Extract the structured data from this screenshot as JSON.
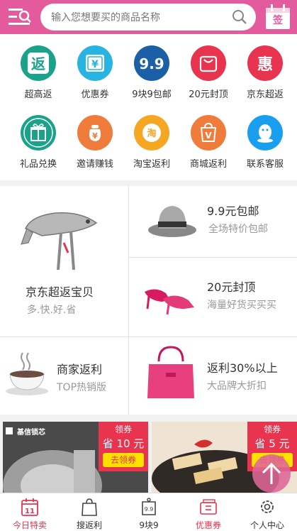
{
  "header": {
    "search_placeholder": "输入您想要买的商品名称",
    "sign_label": "签",
    "brand_color": "#e35b9c"
  },
  "grid": {
    "items": [
      {
        "label": "超高返",
        "icon": "fan-icon",
        "color": "#1aa38a",
        "glyph": "返"
      },
      {
        "label": "优惠券",
        "icon": "coupon-icon",
        "color": "#27b4e3",
        "glyph": "¥"
      },
      {
        "label": "9块9包邮",
        "icon": "nine-nine-icon",
        "color": "#1b5fa6",
        "glyph": "9.9"
      },
      {
        "label": "20元封顶",
        "icon": "bag-icon",
        "color": "#e8344e",
        "glyph": ""
      },
      {
        "label": "京东超返",
        "icon": "hui-icon",
        "color": "#e8344e",
        "glyph": "惠"
      },
      {
        "label": "礼品兑换",
        "icon": "gift-icon",
        "color": "#1aa38a",
        "glyph": ""
      },
      {
        "label": "邀请赚钱",
        "icon": "money-bag-icon",
        "color": "#f07c3c",
        "glyph": "¥"
      },
      {
        "label": "淘宝返利",
        "icon": "taobao-icon",
        "color": "#f5a623",
        "glyph": "淘"
      },
      {
        "label": "商城返利",
        "icon": "mall-bag-icon",
        "color": "#f07c3c",
        "glyph": "V"
      },
      {
        "label": "联系客服",
        "icon": "qq-icon",
        "color": "#1a9ff0",
        "glyph": ""
      }
    ]
  },
  "promo": {
    "jd": {
      "title": "京东超返宝贝",
      "sub": "多.快.好.省"
    },
    "p1": {
      "title": "9.9元包邮",
      "sub": "全场特价包邮"
    },
    "p2": {
      "title": "20元封顶",
      "sub": "海量好货买买买"
    },
    "p3": {
      "title": "商家返利",
      "sub": "TOP热销版"
    },
    "p4": {
      "title": "返利30%以上",
      "sub": "大品牌大折扣"
    }
  },
  "products": [
    {
      "tag_top": "领券",
      "tag_mid": "省 10 元",
      "tag_btn": "去领券",
      "brand": "基信锁芯"
    },
    {
      "tag_top": "领券",
      "tag_mid": "省 5 元",
      "tag_btn": "去领券"
    }
  ],
  "nav": {
    "items": [
      {
        "label": "今日特卖",
        "icon": "calendar-icon",
        "active": true,
        "num": "11"
      },
      {
        "label": "搜返利",
        "icon": "shopping-bag-icon",
        "active": false
      },
      {
        "label": "9块9",
        "icon": "tag-99-icon",
        "active": false,
        "num": "9.9"
      },
      {
        "label": "优惠券",
        "icon": "voucher-icon",
        "active": false
      },
      {
        "label": "个人中心",
        "icon": "settings-icon",
        "active": false
      }
    ],
    "active_color": "#e8344e"
  }
}
